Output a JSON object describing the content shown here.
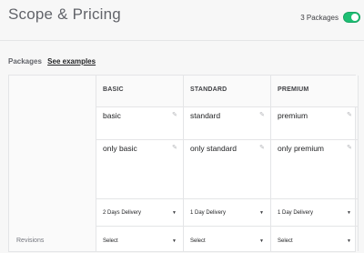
{
  "header": {
    "title": "Scope & Pricing",
    "packages_toggle_label": "3 Packages",
    "packages_toggle_on": true
  },
  "section": {
    "label": "Packages",
    "examples_link": "See examples"
  },
  "table": {
    "row_labels": {
      "revisions": "Revisions"
    },
    "columns": [
      {
        "title": "BASIC",
        "name": "basic",
        "description": "only basic",
        "delivery": "2 Days Delivery",
        "revisions": "Select"
      },
      {
        "title": "STANDARD",
        "name": "standard",
        "description": "only standard",
        "delivery": "1 Day Delivery",
        "revisions": "Select"
      },
      {
        "title": "PREMIUM",
        "name": "premium",
        "description": "only premium",
        "delivery": "1 Day Delivery",
        "revisions": "Select"
      }
    ]
  },
  "colors": {
    "toggle_green": "#1dbf73",
    "border": "#e4e5e7",
    "page_bg": "#f7f7f7"
  },
  "icons": {
    "edit": "pencil-icon",
    "dropdown": "caret-down-icon",
    "toggle": "switch-icon"
  }
}
